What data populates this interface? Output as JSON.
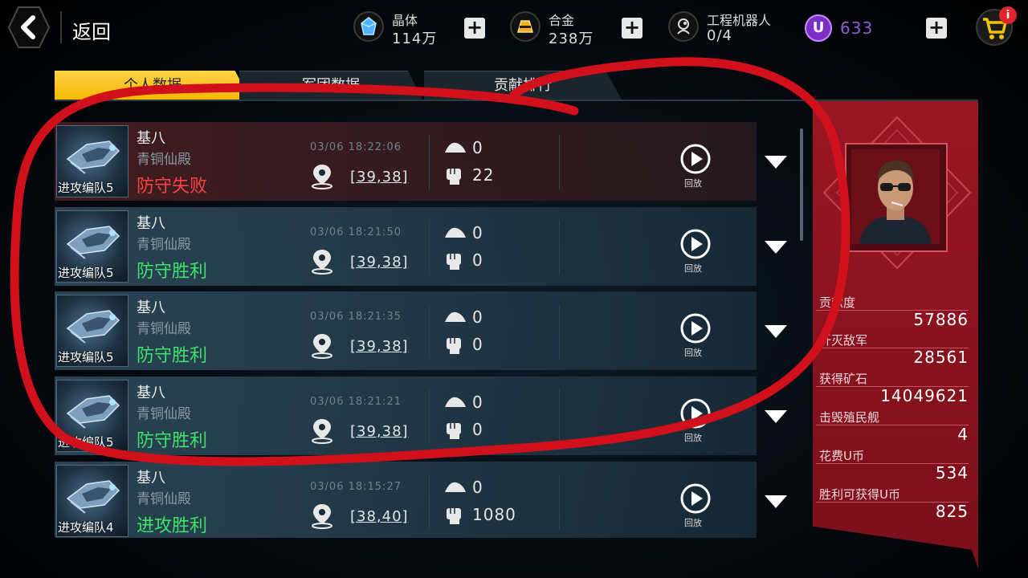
{
  "header": {
    "back_label": "返回",
    "resources": [
      {
        "name": "晶体",
        "value": "114万",
        "icon": "crystal-icon"
      },
      {
        "name": "合金",
        "value": "238万",
        "icon": "alloy-icon"
      },
      {
        "name": "工程机器人",
        "value": "0/4",
        "icon": "robot-icon"
      }
    ],
    "u_coin": {
      "symbol": "U",
      "value": "633"
    },
    "cart_badge": "i"
  },
  "tabs": [
    {
      "label": "个人数据",
      "active": true
    },
    {
      "label": "军团数据",
      "active": false
    },
    {
      "label": "贡献排行",
      "active": false
    }
  ],
  "records": [
    {
      "fleet": "进攻编队5",
      "player": "基八",
      "alliance": "青铜仙殿",
      "result": "防守失败",
      "outcome": "lose",
      "time": "03/06 18:22:06",
      "coords": "[39,38]",
      "resources": "0",
      "power": "22",
      "replay": "回放"
    },
    {
      "fleet": "进攻编队5",
      "player": "基八",
      "alliance": "青铜仙殿",
      "result": "防守胜利",
      "outcome": "win",
      "time": "03/06 18:21:50",
      "coords": "[39,38]",
      "resources": "0",
      "power": "0",
      "replay": "回放"
    },
    {
      "fleet": "进攻编队5",
      "player": "基八",
      "alliance": "青铜仙殿",
      "result": "防守胜利",
      "outcome": "win",
      "time": "03/06 18:21:35",
      "coords": "[39,38]",
      "resources": "0",
      "power": "0",
      "replay": "回放"
    },
    {
      "fleet": "进攻编队5",
      "player": "基八",
      "alliance": "青铜仙殿",
      "result": "防守胜利",
      "outcome": "win",
      "time": "03/06 18:21:21",
      "coords": "[39,38]",
      "resources": "0",
      "power": "0",
      "replay": "回放"
    },
    {
      "fleet": "进攻编队4",
      "player": "基八",
      "alliance": "青铜仙殿",
      "result": "进攻胜利",
      "outcome": "win",
      "time": "03/06 18:15:27",
      "coords": "[38,40]",
      "resources": "0",
      "power": "1080",
      "replay": "回放"
    }
  ],
  "stats": [
    {
      "label": "贡献度",
      "value": "57886"
    },
    {
      "label": "歼灭敌军",
      "value": "28561"
    },
    {
      "label": "获得矿石",
      "value": "14049621"
    },
    {
      "label": "击毁殖民舰",
      "value": "4"
    },
    {
      "label": "花费U币",
      "value": "534"
    },
    {
      "label": "胜利可获得U币",
      "value": "825"
    }
  ],
  "colors": {
    "accent_tab": "#f5b800",
    "win": "#3fe36a",
    "lose": "#ff4040",
    "panel": "#8e1420",
    "annotation": "#d0101a",
    "u_coin": "#7b2fc4"
  }
}
